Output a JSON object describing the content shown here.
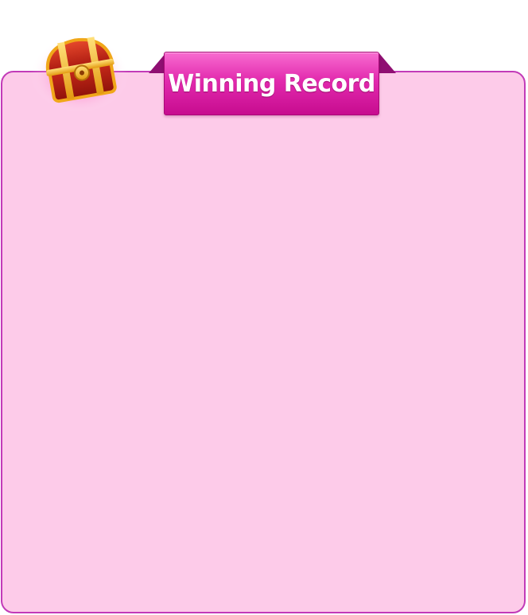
{
  "panel": {
    "title": "Winning Record",
    "icon": "treasure-chest-icon"
  },
  "colors": {
    "panel_background": "#fdcbe9",
    "panel_border": "#c23bb8",
    "ribbon_top": "#f86cd0",
    "ribbon_bottom": "#c70c8f",
    "ribbon_fold": "#8f0f72",
    "chest_red": "#c2261c",
    "chest_gold": "#f4b21e"
  }
}
